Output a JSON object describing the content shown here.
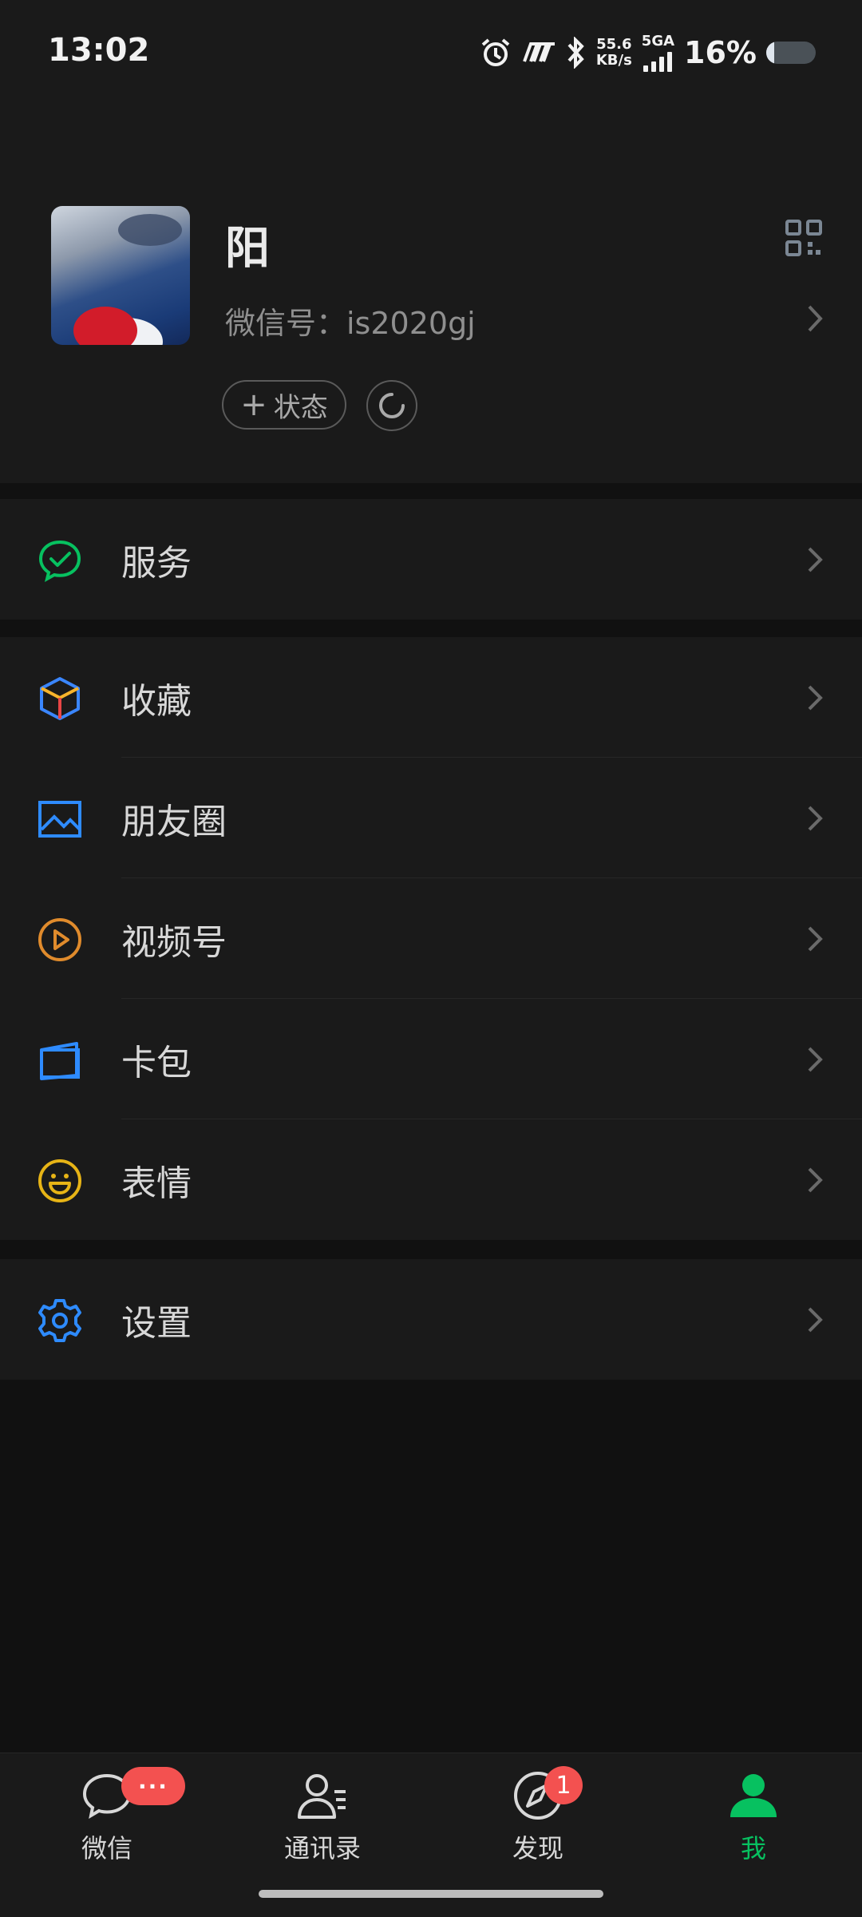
{
  "status_bar": {
    "time": "13:02",
    "net_speed_value": "55.6",
    "net_speed_unit": "KB/s",
    "network": "5GA",
    "battery": "16%",
    "battery_level": 0.16
  },
  "profile": {
    "name": "阳",
    "wechat_id": "微信号：is2020gj",
    "status_button": "状态"
  },
  "menu": {
    "services": "服务",
    "favorites": "收藏",
    "moments": "朋友圈",
    "channels": "视频号",
    "card_wallet": "卡包",
    "stickers": "表情",
    "settings": "设置"
  },
  "tabbar": {
    "chats": "微信",
    "contacts": "通讯录",
    "discover": "发现",
    "me": "我",
    "chats_badge": "···",
    "discover_badge": "1"
  },
  "colors": {
    "accent_green": "#07c160",
    "badge_red": "#f35150",
    "background": "#111111",
    "panel": "#1a1a1a"
  }
}
